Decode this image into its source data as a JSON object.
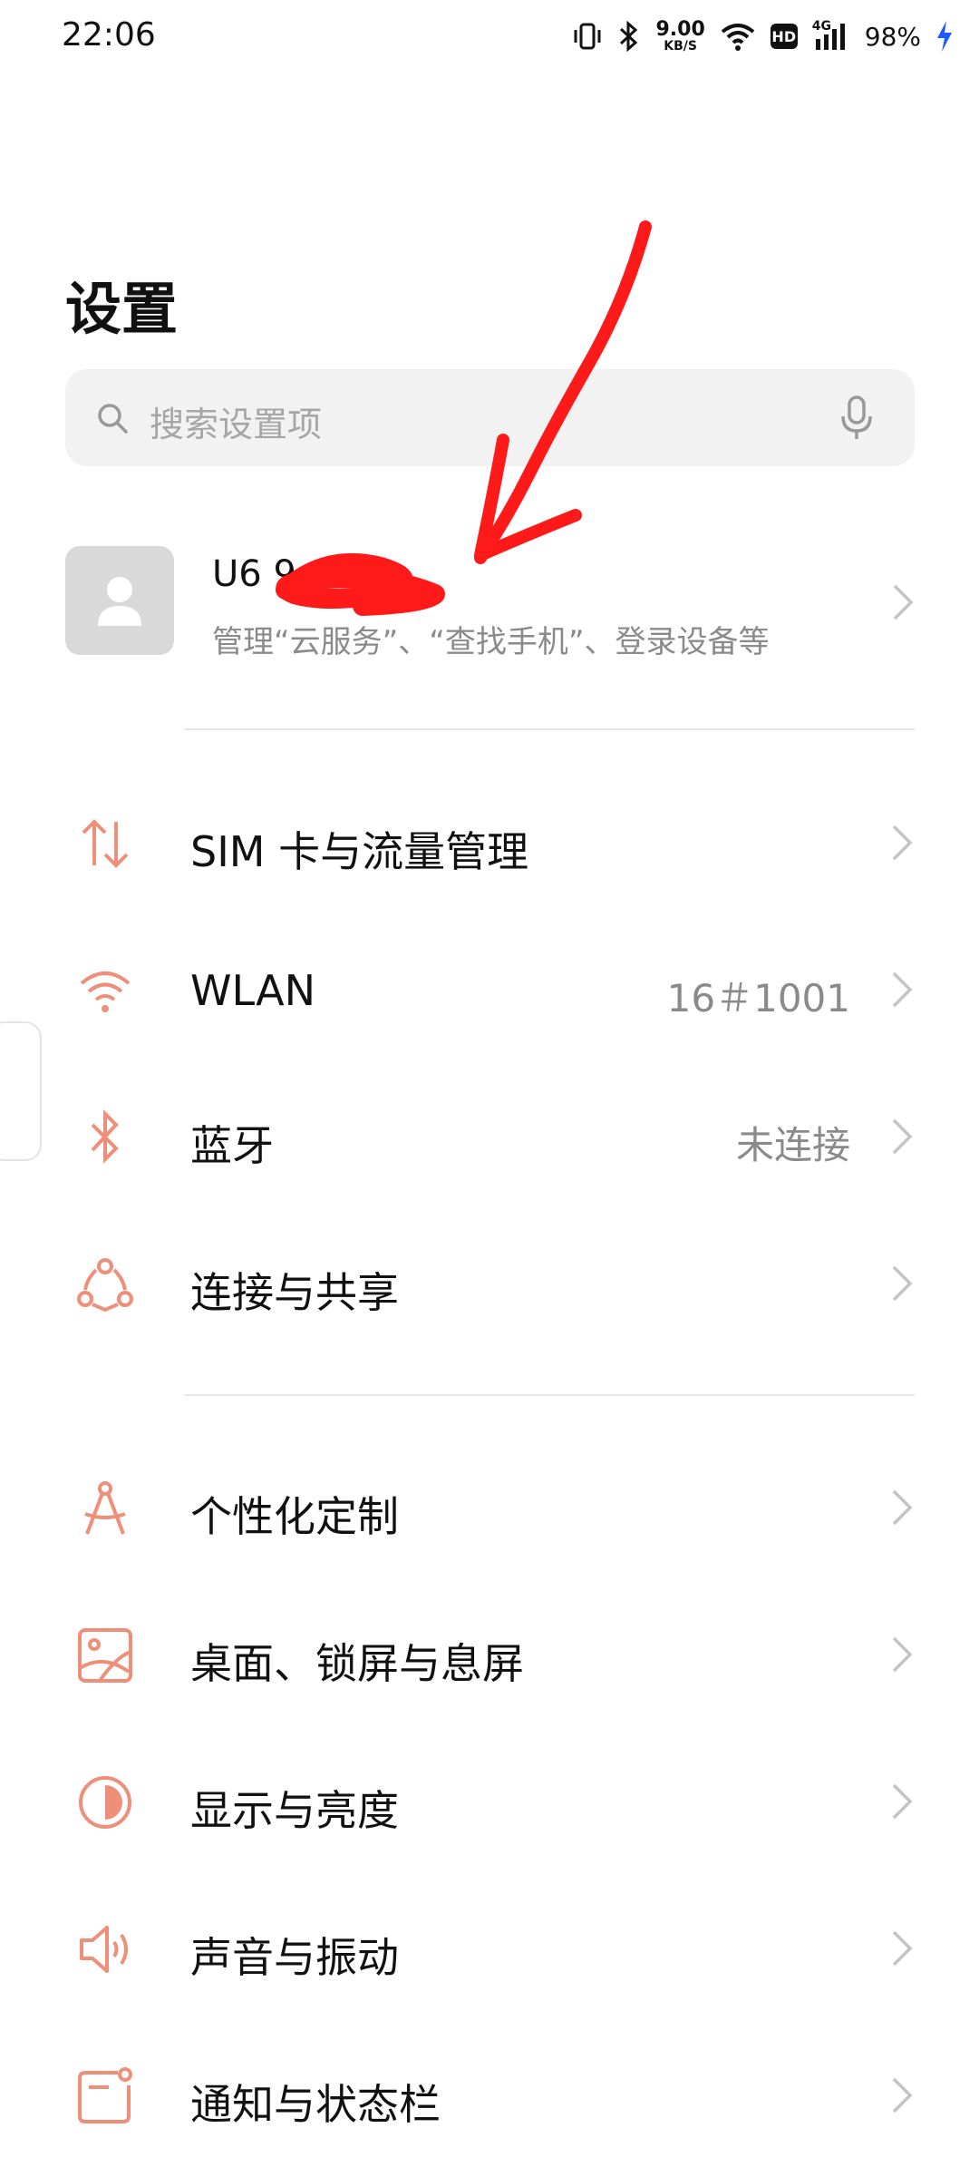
{
  "status_bar": {
    "time": "22:06",
    "net_speed_value": "9.00",
    "net_speed_unit": "KB/S",
    "hd_badge": "HD",
    "network_type": "4G",
    "battery": "98%",
    "icons": [
      "vibrate-icon",
      "bluetooth-icon",
      "wifi-icon",
      "hd-icon",
      "signal-icon",
      "charging-icon"
    ]
  },
  "title": "设置",
  "search": {
    "placeholder": "搜索设置项",
    "icons": [
      "search-icon",
      "mic-icon"
    ]
  },
  "account": {
    "name_visible": "U6                9",
    "subtitle": "管理“云服务”、“查找手机”、登录设备等"
  },
  "groups": [
    {
      "items": [
        {
          "label": "SIM 卡与流量管理",
          "value": "",
          "icon": "sim-data-icon"
        },
        {
          "label": "WLAN",
          "value": "16＃1001",
          "icon": "wifi-icon"
        },
        {
          "label": "蓝牙",
          "value": "未连接",
          "icon": "bluetooth-icon"
        },
        {
          "label": "连接与共享",
          "value": "",
          "icon": "share-connection-icon"
        }
      ]
    },
    {
      "items": [
        {
          "label": "个性化定制",
          "value": "",
          "icon": "compass-icon"
        },
        {
          "label": "桌面、锁屏与息屏",
          "value": "",
          "icon": "wallpaper-icon"
        },
        {
          "label": "显示与亮度",
          "value": "",
          "icon": "display-brightness-icon"
        },
        {
          "label": "声音与振动",
          "value": "",
          "icon": "speaker-icon"
        },
        {
          "label": "通知与状态栏",
          "value": "",
          "icon": "notification-icon"
        }
      ]
    }
  ],
  "colors": {
    "accent_icon": "#ef8f7a",
    "annotation_red": "#ff1a1a",
    "text_primary": "#111111",
    "text_secondary": "#8a8a8a"
  }
}
